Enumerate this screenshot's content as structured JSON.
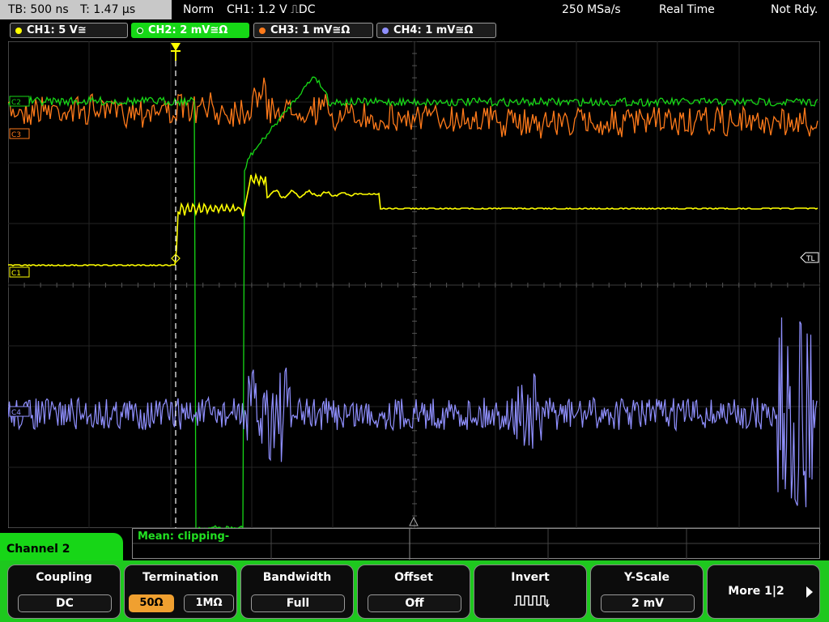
{
  "status": {
    "timebase": "TB: 500 ns",
    "time": "T: 1.47 µs",
    "trigger_mode": "Norm",
    "trigger_info": "CH1: 1.2 V ⎍DC",
    "sample_rate": "250 MSa/s",
    "acq_mode": "Real Time",
    "state": "Not Rdy."
  },
  "channels": [
    {
      "label": "CH1: 5 V≅",
      "color": "#ffff00",
      "active": false
    },
    {
      "label": "CH2: 2 mV≅Ω",
      "color": "#16d816",
      "active": true
    },
    {
      "label": "CH3: 1 mV≅Ω",
      "color": "#ff7a1a",
      "active": false
    },
    {
      "label": "CH4: 1 mV≅Ω",
      "color": "#9090ff",
      "active": false
    }
  ],
  "markers": {
    "c2": "C2",
    "c3": "C3",
    "c1": "C1",
    "c4": "C4",
    "tl": "TL"
  },
  "measurement": {
    "text": "Mean: clipping-"
  },
  "menu": {
    "channel_title": "Channel 2",
    "coupling": {
      "title": "Coupling",
      "value": "DC"
    },
    "termination": {
      "title": "Termination",
      "opt1": "50Ω",
      "opt2": "1MΩ",
      "selected": "50Ω"
    },
    "bandwidth": {
      "title": "Bandwidth",
      "value": "Full"
    },
    "offset": {
      "title": "Offset",
      "value": "Off"
    },
    "invert": {
      "title": "Invert",
      "icon": "invert-pulse-icon"
    },
    "yscale": {
      "title": "Y-Scale",
      "value": "2 mV"
    },
    "more": {
      "title": "More 1|2"
    }
  }
}
